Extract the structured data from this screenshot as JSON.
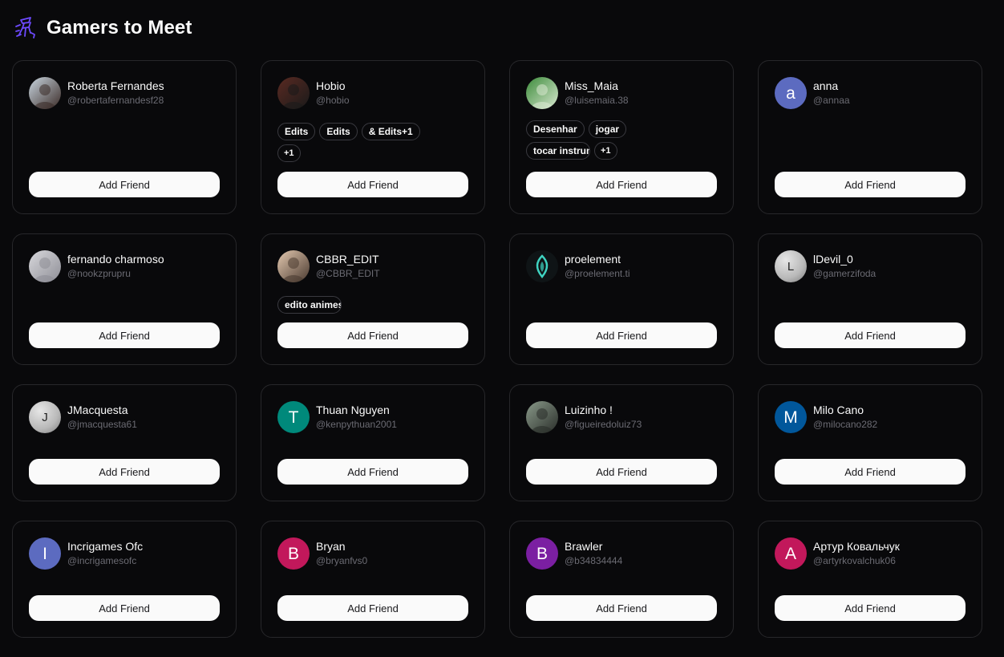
{
  "header": {
    "title": "Gamers to Meet",
    "icon": "gamer-logo-icon",
    "icon_color": "#6d4aff"
  },
  "add_friend_label": "Add Friend",
  "users": [
    {
      "name": "Roberta Fernandes",
      "handle": "@robertafernandesf28",
      "avatar": {
        "type": "photo",
        "colors": [
          "#c9d6e0",
          "#3b2c28"
        ]
      },
      "tags": []
    },
    {
      "name": "Hobio",
      "handle": "@hobio",
      "avatar": {
        "type": "photo",
        "colors": [
          "#5a2a22",
          "#1a1a1a"
        ]
      },
      "tags": [
        "Edits",
        "Edits",
        "& Edits+1",
        "+1"
      ]
    },
    {
      "name": "Miss_Maia",
      "handle": "@luisemaia.38",
      "avatar": {
        "type": "photo",
        "colors": [
          "#3c8b3a",
          "#d8e8d0"
        ]
      },
      "tags": [
        "Desenhar",
        "jogar",
        "tocar instrum",
        "+1"
      ]
    },
    {
      "name": "anna",
      "handle": "@annaa",
      "avatar": {
        "type": "initial",
        "letter": "a",
        "color": "#5c6bc0"
      },
      "tags": []
    },
    {
      "name": "fernando charmoso",
      "handle": "@nookzprupru",
      "avatar": {
        "type": "photo",
        "colors": [
          "#d8d8dc",
          "#8e8e96"
        ]
      },
      "tags": []
    },
    {
      "name": "CBBR_EDIT",
      "handle": "@CBBR_EDIT",
      "avatar": {
        "type": "photo",
        "colors": [
          "#e4c9b0",
          "#4a3a30"
        ]
      },
      "tags": [
        "edito animes"
      ]
    },
    {
      "name": "proelement",
      "handle": "@proelement.ti",
      "avatar": {
        "type": "logo",
        "colors": [
          "#0f1416",
          "#3fd3c1"
        ]
      },
      "tags": []
    },
    {
      "name": "lDevil_0",
      "handle": "@gamerzifoda",
      "avatar": {
        "type": "initial-gray",
        "letter": "L",
        "color": "#b8b8b8"
      },
      "tags": []
    },
    {
      "name": "JMacquesta",
      "handle": "@jmacquesta61",
      "avatar": {
        "type": "initial-gray",
        "letter": "J",
        "color": "#b8b8b8"
      },
      "tags": []
    },
    {
      "name": "Thuan Nguyen",
      "handle": "@kenpythuan2001",
      "avatar": {
        "type": "initial",
        "letter": "T",
        "color": "#00897b"
      },
      "tags": []
    },
    {
      "name": "Luizinho !",
      "handle": "@figueiredoluiz73",
      "avatar": {
        "type": "photo",
        "colors": [
          "#8a9a8a",
          "#2a2e2a"
        ]
      },
      "tags": []
    },
    {
      "name": "Milo Cano",
      "handle": "@milocano282",
      "avatar": {
        "type": "initial",
        "letter": "M",
        "color": "#01579b"
      },
      "tags": []
    },
    {
      "name": "Incrigames Ofc",
      "handle": "@incrigamesofc",
      "avatar": {
        "type": "initial",
        "letter": "I",
        "color": "#5c6bc0"
      },
      "tags": []
    },
    {
      "name": "Bryan",
      "handle": "@bryanfvs0",
      "avatar": {
        "type": "initial",
        "letter": "B",
        "color": "#c2185b"
      },
      "tags": []
    },
    {
      "name": "Brawler",
      "handle": "@b34834444",
      "avatar": {
        "type": "initial",
        "letter": "B",
        "color": "#7b1fa2"
      },
      "tags": []
    },
    {
      "name": "Артур Ковальчук",
      "handle": "@artyrkovalchuk06",
      "avatar": {
        "type": "initial",
        "letter": "A",
        "color": "#c2185b"
      },
      "tags": []
    }
  ]
}
